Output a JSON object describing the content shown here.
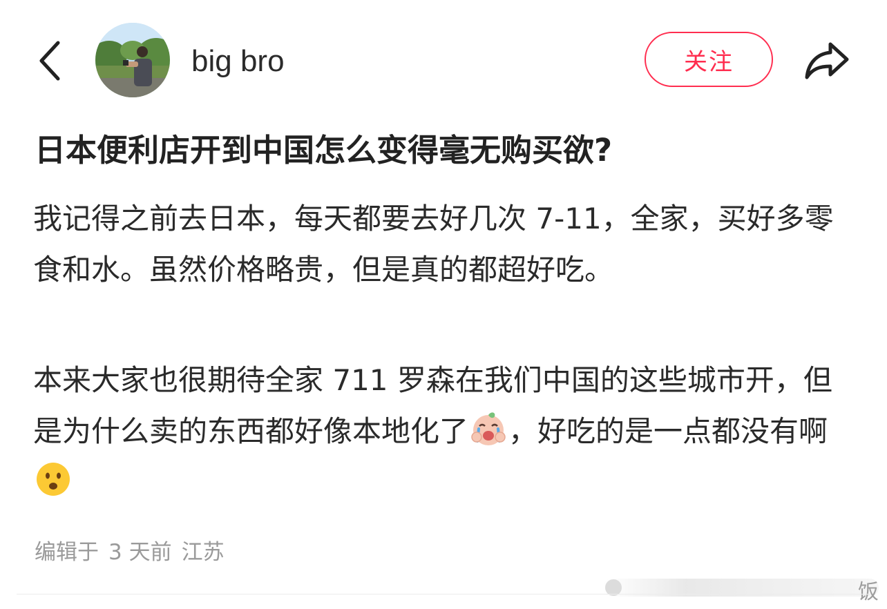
{
  "header": {
    "username": "big bro",
    "follow_label": "关注",
    "back_icon": "chevron-left-icon",
    "share_icon": "share-arrow-icon"
  },
  "post": {
    "title": "日本便利店开到中国怎么变得毫无购买欲?",
    "paragraph1": "我记得之前去日本，每天都要去好几次 7-11，全家，买好多零食和水。虽然价格略贵，但是真的都超好吃。",
    "paragraph2_part1": "本来大家也很期待全家 711 罗森在我们中国的这些城市开，但是为什么卖的东西都好像本地化了",
    "emoji1": "crying-baby-emoji-icon",
    "paragraph2_part2": "，好吃的是一点都没有啊",
    "emoji2": "frowning-face-emoji-icon",
    "meta": {
      "edited": "编辑于",
      "time": "3 天前",
      "location": "江苏"
    }
  },
  "watermark": {
    "text": "饭"
  },
  "colors": {
    "accent": "#ff2d4f",
    "text": "#222222",
    "meta": "#9a9a9a"
  }
}
